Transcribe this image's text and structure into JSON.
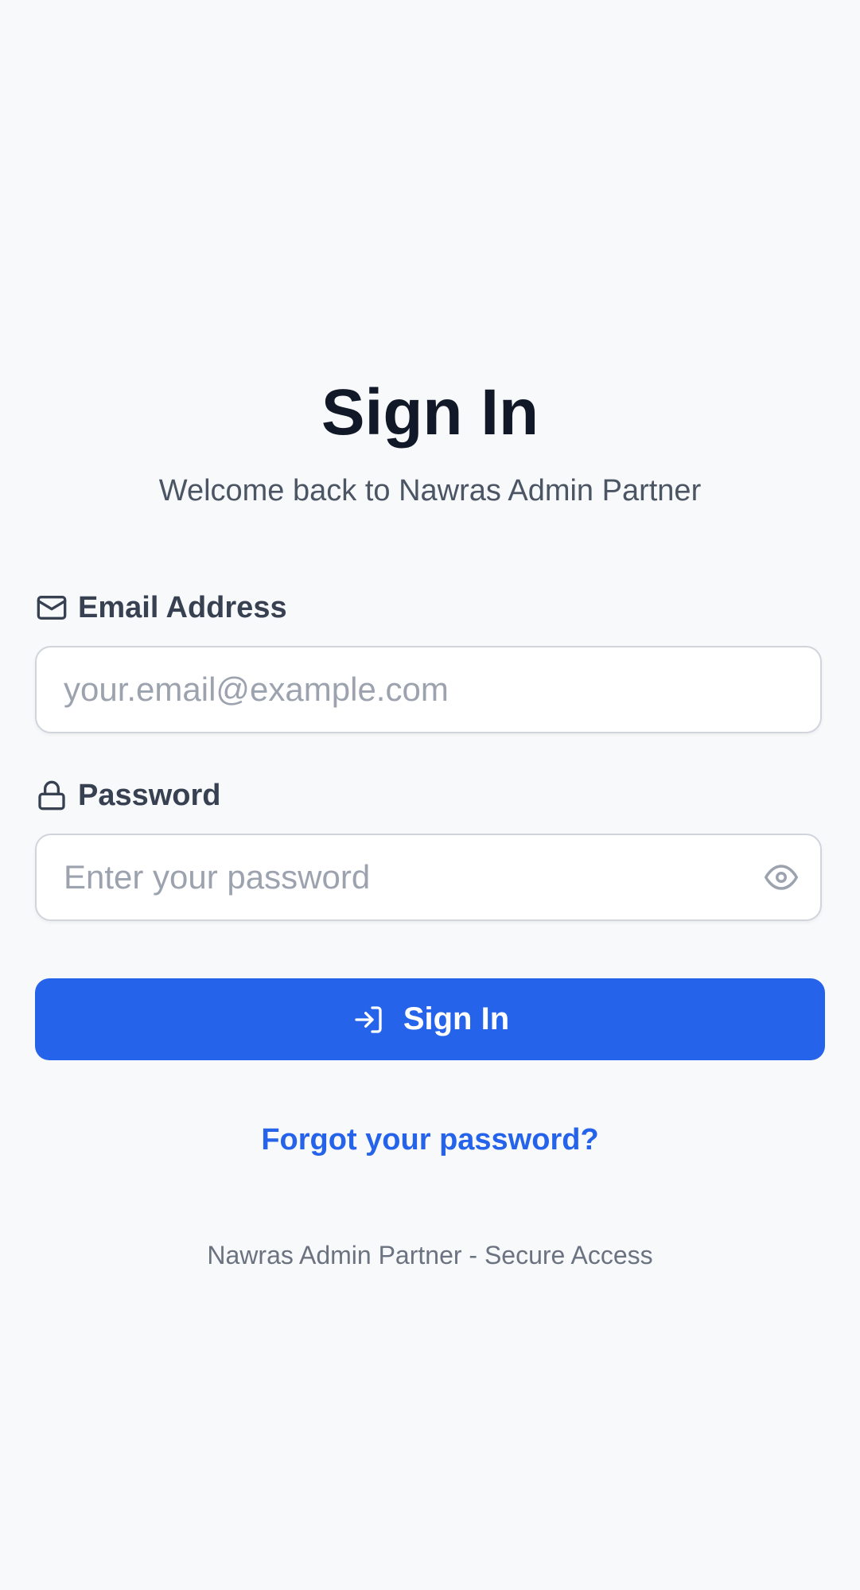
{
  "header": {
    "title": "Sign In",
    "subtitle": "Welcome back to Nawras Admin Partner"
  },
  "form": {
    "email": {
      "label": "Email Address",
      "icon": "mail-icon",
      "value": "",
      "placeholder": "your.email@example.com"
    },
    "password": {
      "label": "Password",
      "icon": "lock-icon",
      "value": "",
      "placeholder": "Enter your password",
      "toggle_icon": "eye-icon"
    },
    "submit": {
      "label": "Sign In",
      "icon": "log-in-icon"
    },
    "forgot_link": "Forgot your password?"
  },
  "footer": {
    "text": "Nawras Admin Partner - Secure Access"
  },
  "colors": {
    "background": "#f8f9fb",
    "primary": "#2563eb",
    "title": "#111827",
    "muted": "#6b7280"
  }
}
